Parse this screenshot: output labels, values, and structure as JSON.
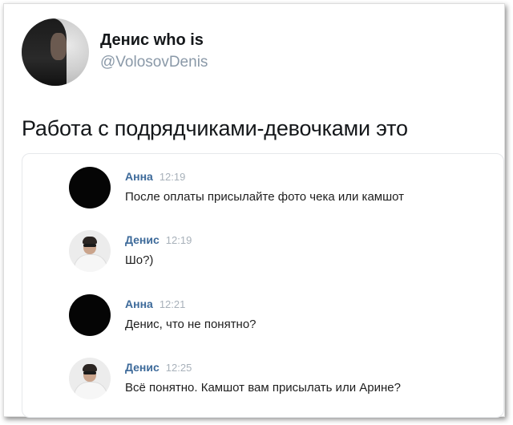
{
  "tweet": {
    "author_name": "Денис who is",
    "handle": "@VolosovDenis",
    "text": "Работа с подрядчиками-девочками это"
  },
  "screenshot": {
    "messages": [
      {
        "author": "Анна",
        "time": "12:19",
        "text": "После оплаты присылайте фото чека или камшот",
        "avatar": "black-circle"
      },
      {
        "author": "Денис",
        "time": "12:19",
        "text": "Шо?)",
        "avatar": "photo"
      },
      {
        "author": "Анна",
        "time": "12:21",
        "text": "Денис, что не понятно?",
        "avatar": "black-circle"
      },
      {
        "author": "Денис",
        "time": "12:25",
        "text": "Всё понятно. Камшот вам присылать или Арине?",
        "avatar": "photo"
      }
    ]
  },
  "colors": {
    "author_link": "#3d6a9a",
    "handle": "#8a99a8",
    "time": "#a8b1ba"
  }
}
